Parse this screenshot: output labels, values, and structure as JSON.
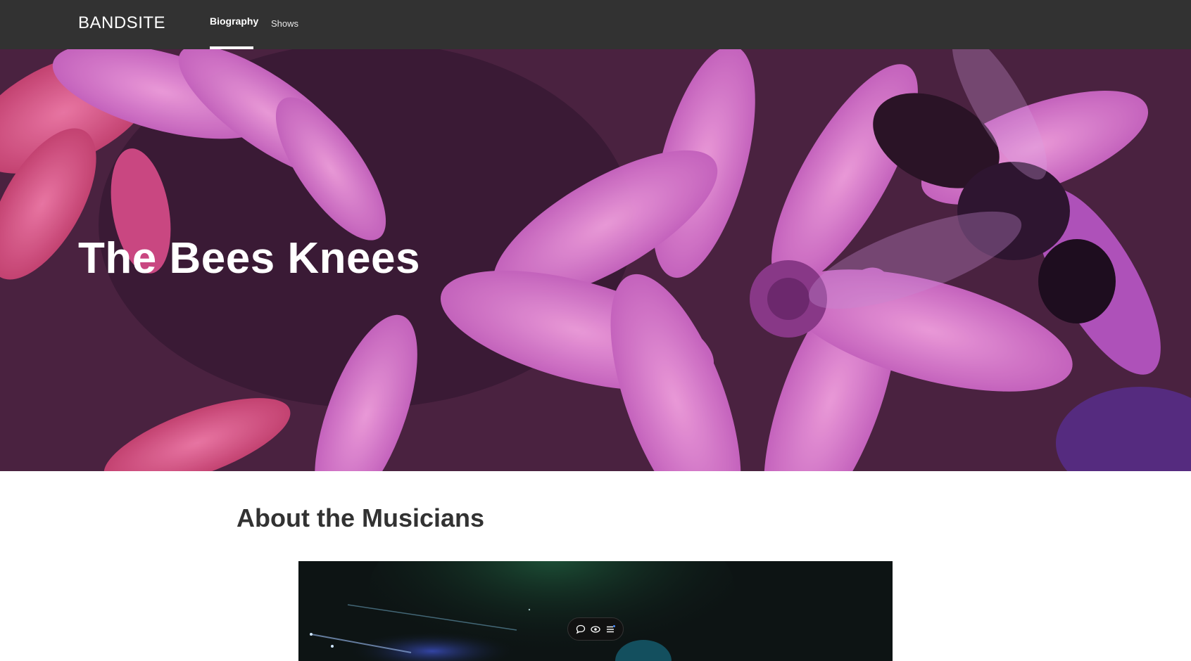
{
  "nav": {
    "logo": "BANDSITE",
    "links": [
      {
        "label": "Biography",
        "active": true
      },
      {
        "label": "Shows",
        "active": false
      }
    ]
  },
  "hero": {
    "title": "The Bees Knees"
  },
  "about": {
    "title": "About the Musicians"
  },
  "toolbar": {
    "icons": [
      "comment-icon",
      "eye-icon",
      "menu-icon"
    ]
  },
  "colors": {
    "navbar": "#323232",
    "text_dark": "#323232",
    "white": "#ffffff",
    "hero_tint": "#a948b4"
  }
}
